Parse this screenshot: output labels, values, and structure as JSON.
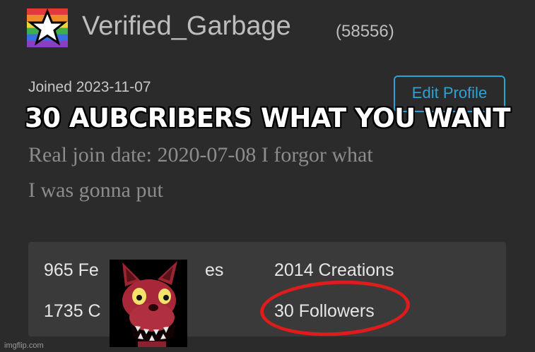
{
  "profile": {
    "username": "Verified_Garbage",
    "points": "(58556)",
    "joined": "Joined 2023-11-07",
    "edit_profile_label": "Edit Profile",
    "bio_line1": "Real join date: 2020-07-08 I forgor what",
    "bio_line2": "I was gonna put"
  },
  "caption": "30 AUBCRIBERS WHAT YOU WANT",
  "stats": {
    "favorites": "965 Fe",
    "likes": "es",
    "creations": "2014 Creations",
    "comments": "1735 C",
    "followers": "30 Followers"
  },
  "icons": {
    "badge": "pride-star-icon",
    "sticker": "foxy-animatronic-sticker"
  },
  "colors": {
    "background": "#2b2b2b",
    "accent": "#2aa3d6",
    "highlight_circle": "#e01b1b"
  },
  "watermark": "imgflip.com"
}
